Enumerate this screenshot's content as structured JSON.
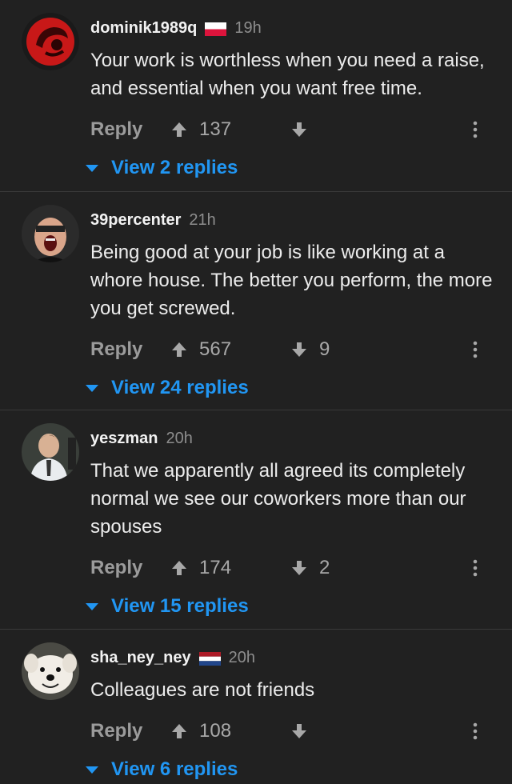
{
  "comments": [
    {
      "username": "dominik1989q",
      "flag": "poland",
      "time": "19h",
      "text": "Your work is worthless when you need a raise, and essential when you want free time.",
      "reply_label": "Reply",
      "upvotes": "137",
      "downvotes": "",
      "replies_label": "View 2 replies"
    },
    {
      "username": "39percenter",
      "flag": "",
      "time": "21h",
      "text": "Being good at your job is like working at a whore house. The better you perform, the more you get screwed.",
      "reply_label": "Reply",
      "upvotes": "567",
      "downvotes": "9",
      "replies_label": "View 24 replies"
    },
    {
      "username": "yeszman",
      "flag": "",
      "time": "20h",
      "text": "That we apparently all agreed its completely normal we see our coworkers more than our spouses",
      "reply_label": "Reply",
      "upvotes": "174",
      "downvotes": "2",
      "replies_label": "View 15 replies"
    },
    {
      "username": "sha_ney_ney",
      "flag": "netherlands",
      "time": "20h",
      "text": "Colleagues are not friends",
      "reply_label": "Reply",
      "upvotes": "108",
      "downvotes": "",
      "replies_label": "View 6 replies"
    }
  ],
  "colors": {
    "background": "#212121",
    "accent": "#2196f3",
    "muted": "#8d8d8d"
  }
}
